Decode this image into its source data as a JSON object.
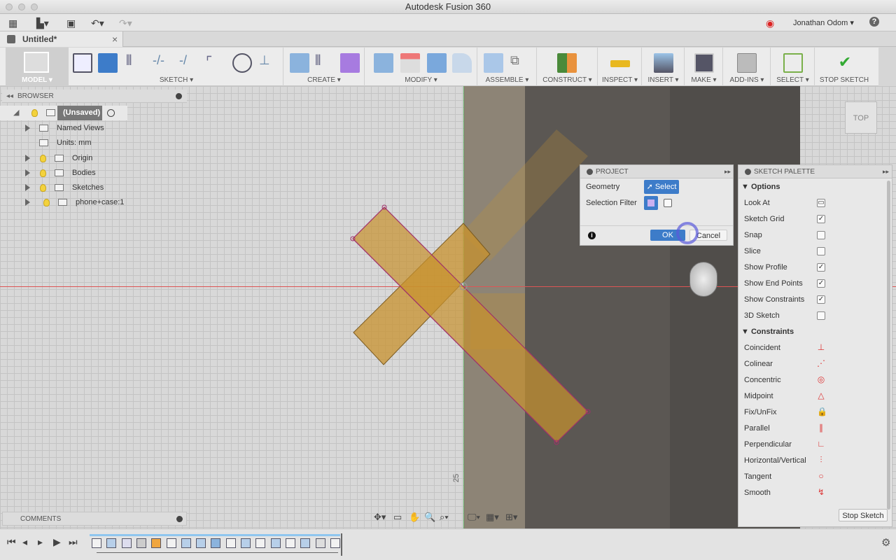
{
  "window": {
    "title": "Autodesk Fusion 360"
  },
  "qat": {
    "user": "Jonathan Odom",
    "help": "?",
    "icons": [
      "app-grid-icon",
      "file-icon",
      "save-icon",
      "undo-icon",
      "redo-icon"
    ]
  },
  "doc_tab": {
    "label": "Untitled*",
    "close": "×"
  },
  "ribbon": {
    "workspace": "MODEL",
    "groups": [
      {
        "label": "SKETCH"
      },
      {
        "label": "CREATE"
      },
      {
        "label": "MODIFY"
      },
      {
        "label": "ASSEMBLE"
      },
      {
        "label": "CONSTRUCT"
      },
      {
        "label": "INSPECT"
      },
      {
        "label": "INSERT"
      },
      {
        "label": "MAKE"
      },
      {
        "label": "ADD-INS"
      },
      {
        "label": "SELECT"
      },
      {
        "label": "STOP SKETCH"
      }
    ]
  },
  "browser": {
    "title": "BROWSER",
    "items": [
      {
        "label": "(Unsaved)"
      },
      {
        "label": "Named Views"
      },
      {
        "label": "Units: mm"
      },
      {
        "label": "Origin"
      },
      {
        "label": "Bodies"
      },
      {
        "label": "Sketches"
      },
      {
        "label": "phone+case:1"
      }
    ]
  },
  "comments": {
    "title": "COMMENTS"
  },
  "viewcube": {
    "label": "TOP"
  },
  "canvas": {
    "dimension_label": "25",
    "sketch_color": "#a0306a",
    "body_color": "#c8922e"
  },
  "project": {
    "title": "PROJECT",
    "geometry_label": "Geometry",
    "select_label": "Select",
    "filter_label": "Selection Filter",
    "ok": "OK",
    "cancel": "Cancel"
  },
  "palette": {
    "title": "SKETCH PALETTE",
    "options_title": "Options",
    "options": [
      {
        "label": "Look At",
        "type": "icon"
      },
      {
        "label": "Sketch Grid",
        "checked": true
      },
      {
        "label": "Snap",
        "checked": false
      },
      {
        "label": "Slice",
        "checked": false
      },
      {
        "label": "Show Profile",
        "checked": true
      },
      {
        "label": "Show End Points",
        "checked": true
      },
      {
        "label": "Show Constraints",
        "checked": true
      },
      {
        "label": "3D Sketch",
        "checked": false
      }
    ],
    "constraints_title": "Constraints",
    "constraints": [
      {
        "label": "Coincident",
        "glyph": "⊥"
      },
      {
        "label": "Colinear",
        "glyph": "⋰"
      },
      {
        "label": "Concentric",
        "glyph": "◎"
      },
      {
        "label": "Midpoint",
        "glyph": "△"
      },
      {
        "label": "Fix/UnFix",
        "glyph": "🔒"
      },
      {
        "label": "Parallel",
        "glyph": "∥"
      },
      {
        "label": "Perpendicular",
        "glyph": "∟"
      },
      {
        "label": "Horizontal/Vertical",
        "glyph": "⫶"
      },
      {
        "label": "Tangent",
        "glyph": "○"
      },
      {
        "label": "Smooth",
        "glyph": "↯"
      }
    ],
    "stop_sketch": "Stop Sketch"
  },
  "accent": "#3d7cc9",
  "timeline": {
    "features": [
      "sketch",
      "extrude",
      "fillet",
      "joint",
      "appearance",
      "sketch",
      "extrude",
      "extrude",
      "combine",
      "sketch",
      "extrude",
      "sketch",
      "extrude",
      "sketch",
      "extrude",
      "mirror",
      "sketch"
    ]
  }
}
